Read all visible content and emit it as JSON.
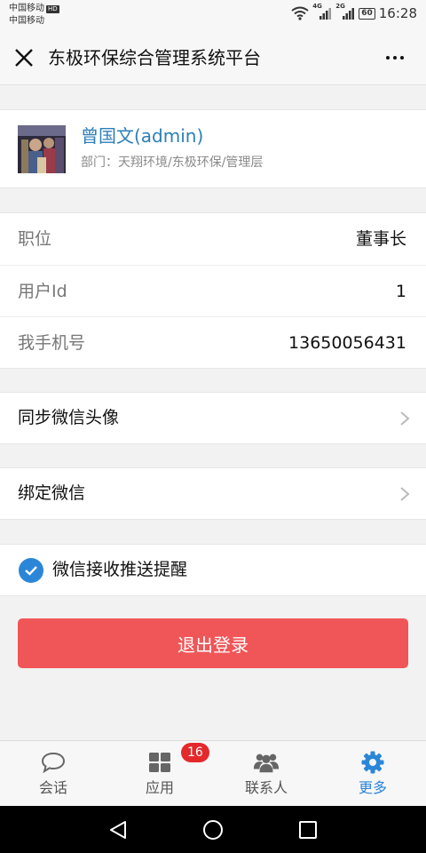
{
  "status_bar": {
    "carrier1": "中国移动",
    "hd_badge": "HD",
    "carrier2": "中国移动",
    "net1": "4G",
    "net2": "2G",
    "battery": "60",
    "time": "16:28"
  },
  "header": {
    "title": "东极环保综合管理系统平台",
    "close_icon": "close-icon",
    "more_icon": "more-horizontal-icon"
  },
  "profile": {
    "name": "曾国文(admin)",
    "department": "部门：天翔环境/东极环保/管理层"
  },
  "info": [
    {
      "label": "职位",
      "value": "董事长"
    },
    {
      "label": "用户Id",
      "value": "1"
    },
    {
      "label": "我手机号",
      "value": "13650056431"
    }
  ],
  "actions": {
    "sync_avatar": "同步微信头像",
    "bind_wechat": "绑定微信",
    "push_notify": "微信接收推送提醒",
    "push_notify_checked": true,
    "logout": "退出登录"
  },
  "tabbar": {
    "tabs": [
      {
        "label": "会话",
        "icon": "chat-bubble-icon",
        "active": false
      },
      {
        "label": "应用",
        "icon": "grid-apps-icon",
        "active": false,
        "badge": "16"
      },
      {
        "label": "联系人",
        "icon": "contacts-icon",
        "active": false
      },
      {
        "label": "更多",
        "icon": "gear-icon",
        "active": true
      }
    ]
  },
  "colors": {
    "accent": "#2b86d8",
    "name_link": "#2c7fb8",
    "logout": "#f05658",
    "badge": "#e4292b"
  }
}
